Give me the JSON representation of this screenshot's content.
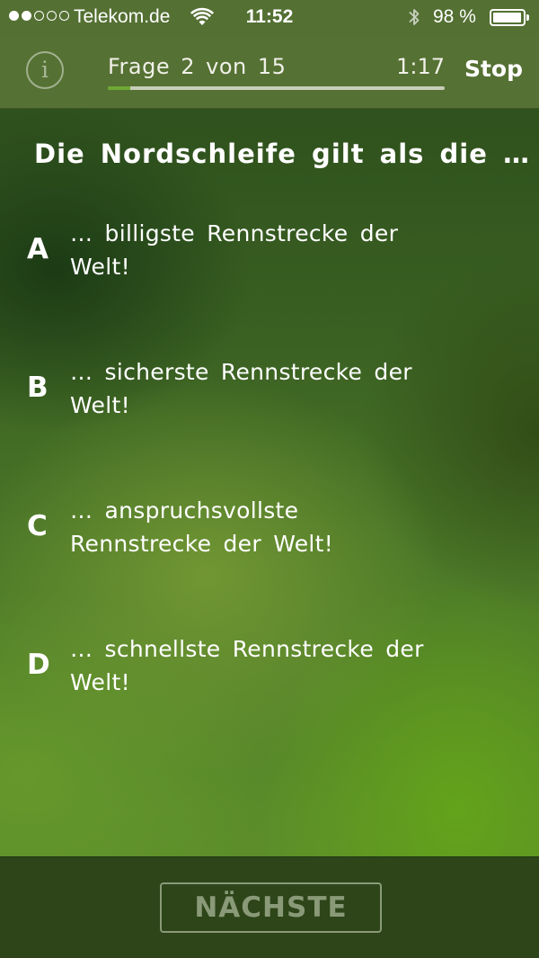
{
  "status_bar": {
    "signal_bars_filled": 2,
    "signal_bars_total": 5,
    "carrier": "Telekom.de",
    "time": "11:52",
    "battery_percent": "98 %",
    "battery_level": 0.98,
    "icons": [
      "signal-dots",
      "wifi-icon",
      "bluetooth-icon",
      "battery-icon"
    ]
  },
  "header": {
    "info_symbol": "i",
    "counter": "Frage 2 von 15",
    "timer": "1:17",
    "stop_label": "Stop",
    "progress": 0.067
  },
  "quiz": {
    "question": "Die Nordschleife gilt als die …",
    "answers": [
      {
        "letter": "A",
        "text": "… billigste Rennstrecke der Welt!"
      },
      {
        "letter": "B",
        "text": "… sicherste Rennstrecke der Welt!"
      },
      {
        "letter": "C",
        "text": "… anspruchsvollste Rennstrecke der Welt!"
      },
      {
        "letter": "D",
        "text": "… schnellste Rennstrecke der Welt!"
      }
    ]
  },
  "footer": {
    "next_label": "NÄCHSTE"
  },
  "colors": {
    "header_bg": "#557133",
    "footer_bg": "#2d4519",
    "progress_fill": "#6ea832",
    "disabled_button": "#8a9a78"
  }
}
